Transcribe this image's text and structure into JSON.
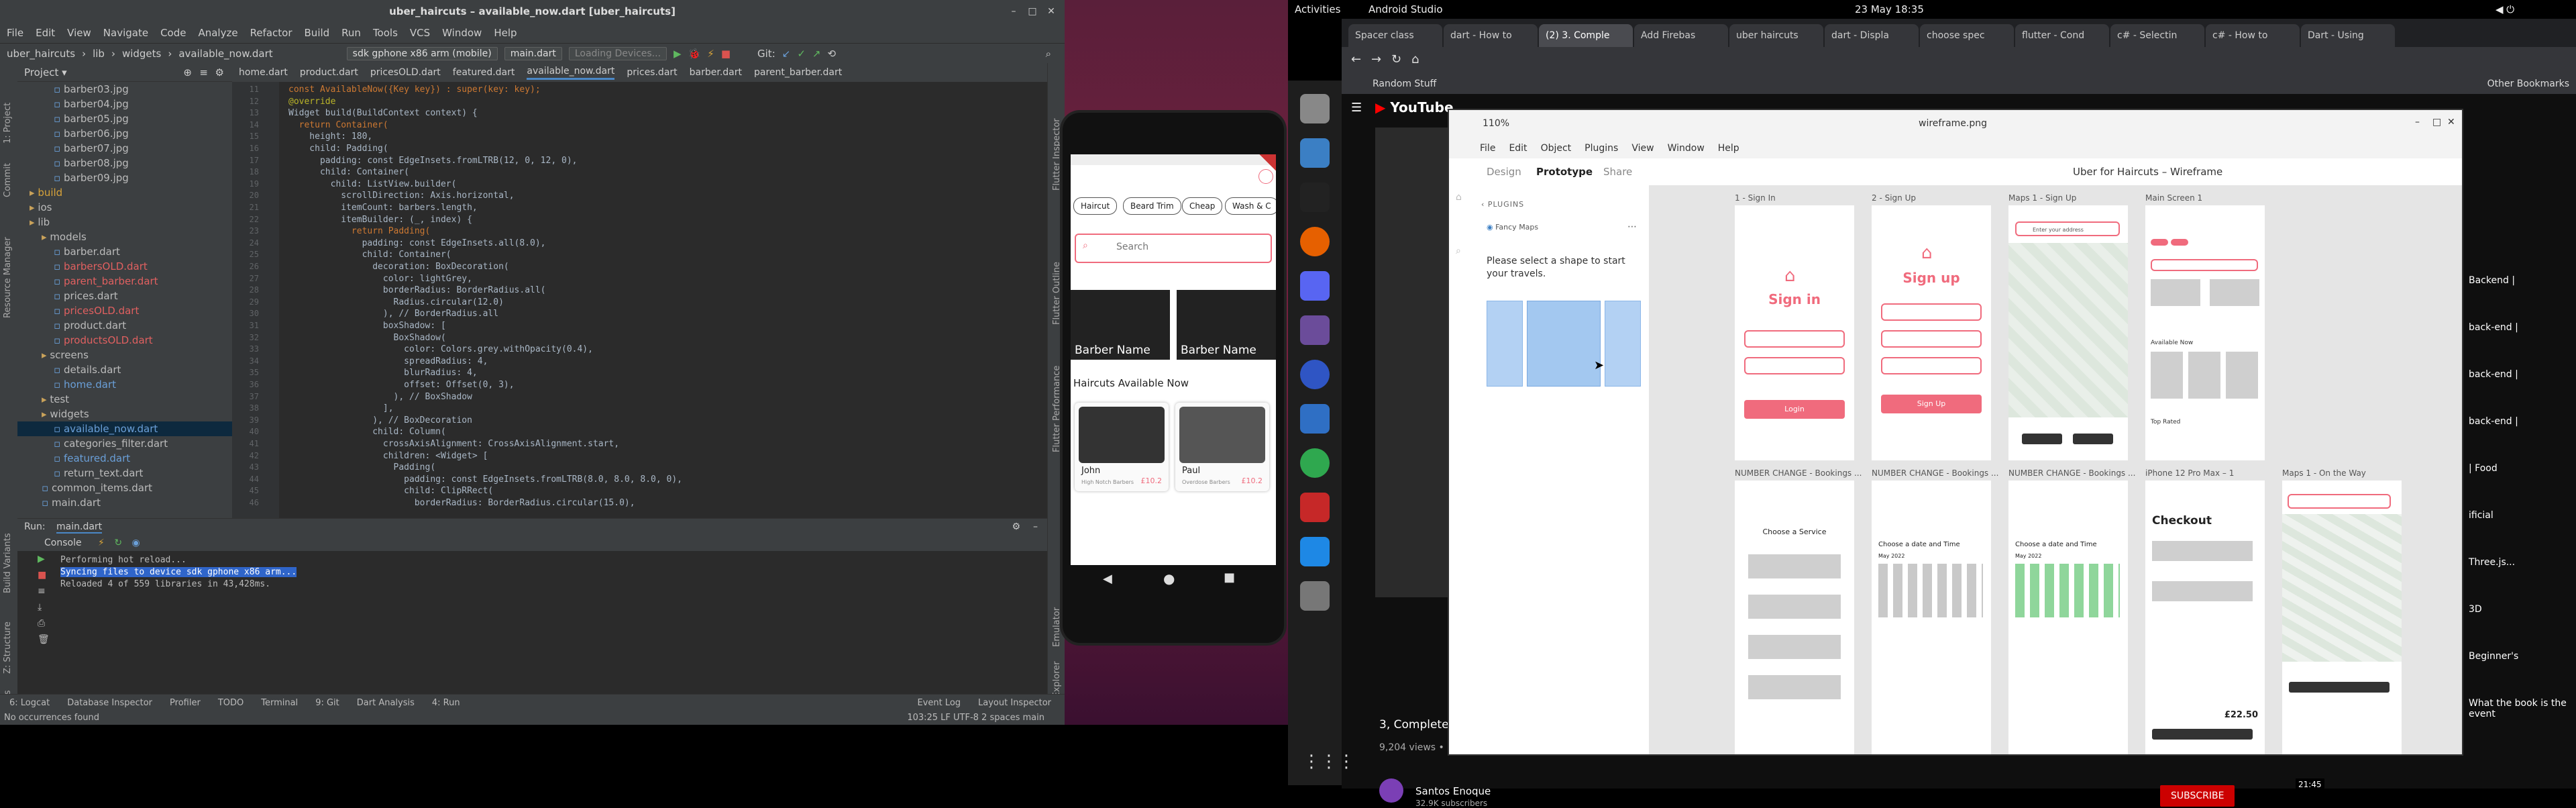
{
  "ide": {
    "title": "uber_haircuts – available_now.dart [uber_haircuts]",
    "menu": [
      "File",
      "Edit",
      "View",
      "Navigate",
      "Code",
      "Analyze",
      "Refactor",
      "Build",
      "Run",
      "Tools",
      "VCS",
      "Window",
      "Help"
    ],
    "breadcrumbs": [
      "uber_haircuts",
      "lib",
      "widgets",
      "available_now.dart"
    ],
    "device": "sdk gphone x86 arm (mobile)",
    "run_config": "main.dart",
    "loading": "Loading Devices...",
    "git_label": "Git:",
    "project_label": "Project",
    "tree": [
      {
        "label": "barber03.jpg",
        "indent": 3,
        "color": "#bbb"
      },
      {
        "label": "barber04.jpg",
        "indent": 3,
        "color": "#bbb"
      },
      {
        "label": "barber05.jpg",
        "indent": 3,
        "color": "#bbb"
      },
      {
        "label": "barber06.jpg",
        "indent": 3,
        "color": "#bbb"
      },
      {
        "label": "barber07.jpg",
        "indent": 3,
        "color": "#bbb"
      },
      {
        "label": "barber08.jpg",
        "indent": 3,
        "color": "#bbb"
      },
      {
        "label": "barber09.jpg",
        "indent": 3,
        "color": "#bbb"
      },
      {
        "label": "build",
        "indent": 1,
        "color": "#d7a33a"
      },
      {
        "label": "ios",
        "indent": 1,
        "color": "#bbb"
      },
      {
        "label": "lib",
        "indent": 1,
        "color": "#bbb"
      },
      {
        "label": "models",
        "indent": 2,
        "color": "#bbb"
      },
      {
        "label": "barber.dart",
        "indent": 3,
        "color": "#bbb"
      },
      {
        "label": "barbersOLD.dart",
        "indent": 3,
        "color": "#e06060"
      },
      {
        "label": "parent_barber.dart",
        "indent": 3,
        "color": "#e06060"
      },
      {
        "label": "prices.dart",
        "indent": 3,
        "color": "#bbb"
      },
      {
        "label": "pricesOLD.dart",
        "indent": 3,
        "color": "#e06060"
      },
      {
        "label": "product.dart",
        "indent": 3,
        "color": "#bbb"
      },
      {
        "label": "productsOLD.dart",
        "indent": 3,
        "color": "#e06060"
      },
      {
        "label": "screens",
        "indent": 2,
        "color": "#bbb"
      },
      {
        "label": "details.dart",
        "indent": 3,
        "color": "#bbb"
      },
      {
        "label": "home.dart",
        "indent": 3,
        "color": "#6a9fd8"
      },
      {
        "label": "test",
        "indent": 2,
        "color": "#bbb"
      },
      {
        "label": "widgets",
        "indent": 2,
        "color": "#bbb"
      },
      {
        "label": "available_now.dart",
        "indent": 3,
        "color": "#6a9fd8"
      },
      {
        "label": "categories_filter.dart",
        "indent": 3,
        "color": "#bbb"
      },
      {
        "label": "featured.dart",
        "indent": 3,
        "color": "#6a9fd8"
      },
      {
        "label": "return_text.dart",
        "indent": 3,
        "color": "#bbb"
      },
      {
        "label": "common_items.dart",
        "indent": 2,
        "color": "#bbb"
      },
      {
        "label": "main.dart",
        "indent": 2,
        "color": "#bbb"
      }
    ],
    "editor_tabs": [
      "home.dart",
      "product.dart",
      "pricesOLD.dart",
      "featured.dart",
      "available_now.dart",
      "prices.dart",
      "barber.dart",
      "parent_barber.dart"
    ],
    "active_tab": "available_now.dart",
    "line_start": 11,
    "code": [
      "const AvailableNow({Key key}) : super(key: key);",
      "@override",
      "Widget build(BuildContext context) {",
      "  return Container(",
      "    height: 180,",
      "    child: Padding(",
      "      padding: const EdgeInsets.fromLTRB(12, 0, 12, 0),",
      "      child: Container(",
      "        child: ListView.builder(",
      "          scrollDirection: Axis.horizontal,",
      "          itemCount: barbers.length,",
      "          itemBuilder: (_, index) {",
      "            return Padding(",
      "              padding: const EdgeInsets.all(8.0),",
      "              child: Container(",
      "                decoration: BoxDecoration(",
      "                  color: lightGrey,",
      "                  borderRadius: BorderRadius.all(",
      "                    Radius.circular(12.0)",
      "                  ), // BorderRadius.all",
      "                  boxShadow: [",
      "                    BoxShadow(",
      "                      color: Colors.grey.withOpacity(0.4),",
      "                      spreadRadius: 4,",
      "                      blurRadius: 4,",
      "                      offset: Offset(0, 3),",
      "                    ), // BoxShadow",
      "                  ],",
      "                ), // BoxDecoration",
      "                child: Column(",
      "                  crossAxisAlignment: CrossAxisAlignment.start,",
      "                  children: <Widget> [",
      "                    Padding(",
      "                      padding: const EdgeInsets.fromLTRB(8.0, 8.0, 8.0, 0),",
      "                      child: ClipRRect(",
      "                        borderRadius: BorderRadius.circular(15.0),"
    ],
    "run_label": "Run:",
    "run_tab": "main.dart",
    "console_tab": "Console",
    "console_lines": [
      "Performing hot reload...",
      "Syncing files to device sdk gphone x86 arm...",
      "Reloaded 4 of 559 libraries in 43,428ms."
    ],
    "bottom_tools": [
      "6: Logcat",
      "Database Inspector",
      "Profiler",
      "TODO",
      "Terminal",
      "9: Git",
      "Dart Analysis",
      "4: Run"
    ],
    "bottom_right": [
      "Event Log",
      "Layout Inspector"
    ],
    "status_left": "No occurrences found",
    "status_right": "103:25  LF  UTF-8  2 spaces  main"
  },
  "phone": {
    "chips": [
      "Haircut",
      "Beard Trim",
      "Cheap",
      "Wash & C"
    ],
    "search_placeholder": "Search",
    "barbers": [
      "Barber Name",
      "Barber Name"
    ],
    "section_title": "Haircuts Available Now",
    "available": [
      {
        "name": "John",
        "subtitle": "High Notch Barbers",
        "price": "£10.2"
      },
      {
        "name": "Paul",
        "subtitle": "Overdose Barbers",
        "price": "£10.2"
      }
    ]
  },
  "desktop": {
    "activities": "Activities",
    "app_name": "Android Studio",
    "clock": "23 May  18:35"
  },
  "chrome": {
    "tabs": [
      "Spacer class",
      "dart - How to",
      "(2) 3. Comple",
      "Add Firebas",
      "uber haircuts",
      "dart - Displa",
      "choose spec",
      "flutter - Cond",
      "c# - Selectin",
      "c# - How to",
      "Dart - Using"
    ],
    "active_tab_index": 2,
    "bookmarks": [
      "Random Stuff",
      "Other Bookmarks"
    ],
    "video_title": "3, Complete fl",
    "video_views": "9,204 views • M",
    "channel": "Santos Enoque",
    "subscribers": "32.9K subscribers",
    "subscribe": "SUBSCRIBE",
    "right_snippets": [
      "Backend |",
      "back-end |",
      "back-end |",
      "back-end |",
      "| Food",
      "ificial",
      "Three.js...",
      "3D",
      "Beginner's",
      "What the book is the event"
    ],
    "time_badge": "21:45"
  },
  "figma": {
    "title": "wireframe.png",
    "zoom": "110%",
    "menu": [
      "File",
      "Edit",
      "Object",
      "Plugins",
      "View",
      "Window",
      "Help"
    ],
    "tabs": [
      "Design",
      "Prototype",
      "Share"
    ],
    "active_tab": "Prototype",
    "file_title": "Uber for Haircuts – Wireframe",
    "plugins_label": "PLUGINS",
    "plugin_name": "Fancy Maps",
    "prompt": "Please select a shape to start your travels.",
    "frames_row1": [
      "1 - Sign In",
      "2 - Sign Up",
      "Maps 1 - Sign Up",
      "Main Screen 1"
    ],
    "frames_row2": [
      "NUMBER CHANGE - Bookings ...",
      "NUMBER CHANGE - Bookings ...",
      "NUMBER CHANGE - Bookings ...",
      "iPhone 12 Pro Max – 1",
      "Maps 1 - On the Way"
    ],
    "signin_title": "Sign in",
    "signup_title": "Sign up",
    "login_btn": "Login",
    "signup_btn": "Sign Up",
    "map_search": "Enter your address",
    "available_now": "Available Now",
    "top_rated": "Top Rated",
    "choose_service": "Choose a Service",
    "choose_datetime": "Choose a date and Time",
    "month": "May 2022",
    "checkout": "Checkout",
    "total": "£22.50"
  },
  "colors": {
    "accent": "#f06b7d",
    "ide_bg": "#2b2b2b",
    "ubuntu_panel": "#000000"
  }
}
